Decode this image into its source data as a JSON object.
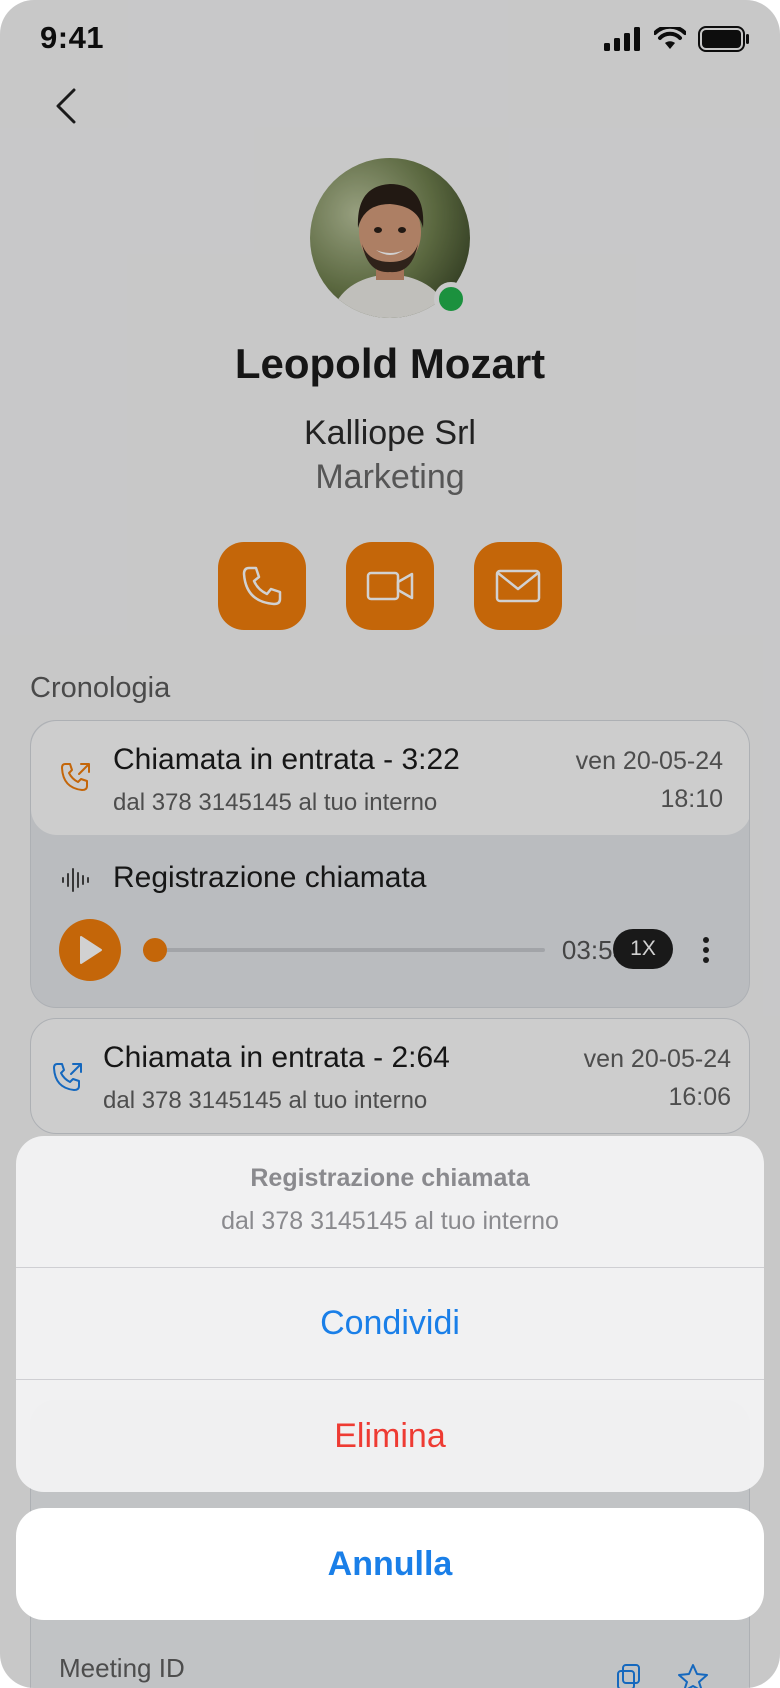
{
  "status_bar": {
    "time": "9:41"
  },
  "contact": {
    "name": "Leopold Mozart",
    "company": "Kalliope Srl",
    "department": "Marketing",
    "presence": "online"
  },
  "colors": {
    "accent": "#f07d0b",
    "presence": "#22b14c",
    "link": "#1a7fe8",
    "danger": "#ee3b33",
    "incoming_call_icon_1": "#f07d0b",
    "incoming_call_icon_2": "#1a7fe8"
  },
  "actions": [
    {
      "icon": "phone-icon"
    },
    {
      "icon": "video-icon"
    },
    {
      "icon": "mail-icon"
    }
  ],
  "history": {
    "title": "Cronologia",
    "items": [
      {
        "title": "Chiamata in entrata - 3:22",
        "subtitle": "dal 378 3145145 al tuo interno",
        "date": "ven 20-05-24",
        "time": "18:10",
        "recording": {
          "label": "Registrazione chiamata",
          "duration": "03:55",
          "speed": "1X",
          "progress_fraction": 0.03
        }
      },
      {
        "title": "Chiamata in entrata - 2:64",
        "subtitle": "dal 378 3145145 al tuo interno",
        "date": "ven 20-05-24",
        "time": "16:06"
      }
    ],
    "meeting_label": "Meeting ID"
  },
  "action_sheet": {
    "title": "Registrazione chiamata",
    "subtitle": "dal 378 3145145 al tuo interno",
    "share_label": "Condividi",
    "delete_label": "Elimina",
    "cancel_label": "Annulla"
  }
}
